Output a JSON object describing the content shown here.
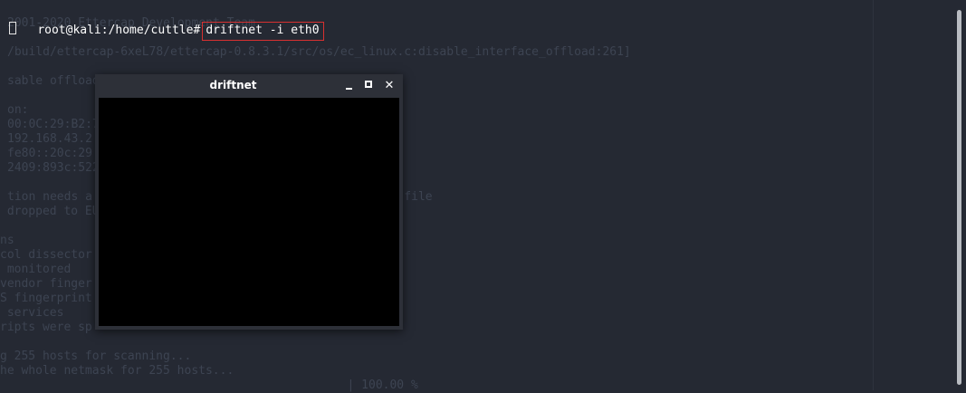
{
  "terminal": {
    "prompt": "root@kali:/home/cuttle#",
    "command": "driftnet -i eth0",
    "background_lines": [
      "2001-2020 Ettercap Development Team",
      "/build/ettercap-6xeL78/ettercap-0.8.3.1/src/os/ec_linux.c:disable_interface_offload:261]",
      "sable offload",
      "on:",
      "00:0C:29:B2:7",
      "192.168.43.2",
      "fe80::20c:29",
      "2409:893c:522",
      "tion needs a                                     r.conf file",
      " dropped to EU",
      "ns",
      "col dissector",
      " monitored",
      "vendor finger",
      "S fingerprint",
      " services",
      "ripts were sp",
      "g 255 hosts for scanning...",
      "he whole netmask for 255 hosts...",
      "                                                 | 100.00 %"
    ]
  },
  "driftnet_window": {
    "title": "driftnet",
    "minimize": "minimize",
    "maximize": "maximize",
    "close": "✕"
  },
  "colors": {
    "terminal_bg": "#252933",
    "highlight_box": "#d83030",
    "window_bg": "#2d3038",
    "canvas_bg": "#000000"
  }
}
